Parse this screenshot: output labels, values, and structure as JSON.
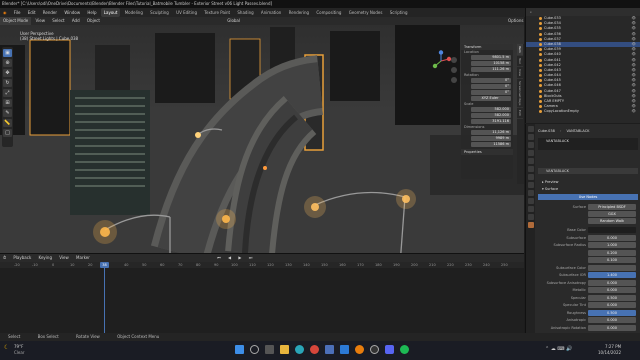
{
  "window": {
    "title": "Blender* [C:\\Users\\odi\\OneDrive\\Documents\\Blender\\Blender Files\\Tutorial_Batmobile Tumbler - Exterior Street v06 Light Passes.blend]",
    "menus": [
      "File",
      "Edit",
      "Render",
      "Window",
      "Help"
    ],
    "workspaces": [
      "Layout",
      "Modeling",
      "Sculpting",
      "UV Editing",
      "Texture Paint",
      "Shading",
      "Animation",
      "Rendering",
      "Compositing",
      "Geometry Nodes",
      "Scripting"
    ],
    "active_workspace": "Layout",
    "scene": "Scene",
    "view_layer": "ViewLayer"
  },
  "viewport": {
    "header_items": [
      "Object Mode",
      "View",
      "Select",
      "Add",
      "Object",
      "Global",
      "Options"
    ],
    "info_line1": "User Perspective",
    "info_line2": "(38) Street Lights | Cube.038",
    "tools": [
      "select",
      "cursor",
      "move",
      "rotate",
      "scale",
      "transform",
      "annotate",
      "measure",
      "add"
    ]
  },
  "npanel": {
    "transform_title": "Transform",
    "location_label": "Location",
    "location": [
      "9801.5 m",
      "10158 m",
      "111.26 m"
    ],
    "rotation_label": "Rotation",
    "rotation": [
      "0°",
      "0°",
      "0°"
    ],
    "mode": "XYZ Euler",
    "scale_label": "Scale",
    "scale": [
      "582.000",
      "582.000",
      "3191.116"
    ],
    "dimensions_label": "Dimensions",
    "dimensions": [
      "11,126 m",
      "9989 m",
      "11586 m"
    ],
    "properties_title": "Properties",
    "tabs": [
      "Item",
      "Tool",
      "View",
      "Screencast Keys",
      "Edit"
    ]
  },
  "timeline": {
    "header_items": [
      "Playback",
      "Keying",
      "View",
      "Marker"
    ],
    "current_frame": "38",
    "ticks": [
      "-20",
      "-10",
      "0",
      "10",
      "20",
      "30",
      "40",
      "50",
      "60",
      "70",
      "80",
      "90",
      "100",
      "110",
      "120",
      "130",
      "140",
      "150",
      "160",
      "170",
      "180",
      "190",
      "200",
      "210",
      "220",
      "230",
      "240",
      "250",
      "260",
      "270"
    ]
  },
  "statusbar": {
    "items": [
      "Select",
      "Box Select",
      "Rotate View",
      "Object Context Menu"
    ]
  },
  "taskbar": {
    "weather_temp": "79°F",
    "weather_desc": "Clear",
    "time": "7:27 PM",
    "date": "10/14/2022"
  },
  "outliner": {
    "rows": [
      {
        "name": "Cube.033",
        "sel": false
      },
      {
        "name": "Cube.034",
        "sel": false
      },
      {
        "name": "Cube.035",
        "sel": false
      },
      {
        "name": "Cube.036",
        "sel": false
      },
      {
        "name": "Cube.037",
        "sel": false
      },
      {
        "name": "Cube.038",
        "sel": true
      },
      {
        "name": "Cube.039",
        "sel": false
      },
      {
        "name": "Cube.040",
        "sel": false
      },
      {
        "name": "Cube.041",
        "sel": false
      },
      {
        "name": "Cube.042",
        "sel": false
      },
      {
        "name": "Cube.043",
        "sel": false
      },
      {
        "name": "Cube.044",
        "sel": false
      },
      {
        "name": "Cube.045",
        "sel": false
      },
      {
        "name": "Cube.046",
        "sel": false
      },
      {
        "name": "Cube.047",
        "sel": false
      },
      {
        "name": "BlockOuts",
        "sel": false
      },
      {
        "name": "CAR EMPTY",
        "sel": false
      },
      {
        "name": "Camera",
        "sel": false
      },
      {
        "name": "CopyLocationEmpty",
        "sel": false
      }
    ]
  },
  "properties": {
    "object": "Cube.038",
    "material": "VANTABLACK",
    "material_slot": "VANTABLACK",
    "preview_label": "Preview",
    "surface_label": "Surface",
    "use_nodes": "Use Nodes",
    "surface_shader": "Principled BSDF",
    "distribution": "GGX",
    "subsurface_method": "Random Walk",
    "fields": [
      {
        "label": "Base Color",
        "value": "",
        "style": "dark"
      },
      {
        "label": "Subsurface",
        "value": "0.000",
        "style": ""
      },
      {
        "label": "Subsurface Radius",
        "value": "1.000",
        "style": ""
      },
      {
        "label": "",
        "value": "0.200",
        "style": ""
      },
      {
        "label": "",
        "value": "0.100",
        "style": ""
      },
      {
        "label": "Subsurface Color",
        "value": "",
        "style": ""
      },
      {
        "label": "Subsurface IOR",
        "value": "1.400",
        "style": "blue"
      },
      {
        "label": "Subsurface Anisotropy",
        "value": "0.000",
        "style": ""
      },
      {
        "label": "Metallic",
        "value": "0.000",
        "style": ""
      },
      {
        "label": "Specular",
        "value": "0.500",
        "style": ""
      },
      {
        "label": "Specular Tint",
        "value": "0.000",
        "style": ""
      },
      {
        "label": "Roughness",
        "value": "0.500",
        "style": "blue"
      },
      {
        "label": "Anisotropic",
        "value": "0.000",
        "style": ""
      },
      {
        "label": "Anisotropic Rotation",
        "value": "0.000",
        "style": ""
      }
    ]
  }
}
